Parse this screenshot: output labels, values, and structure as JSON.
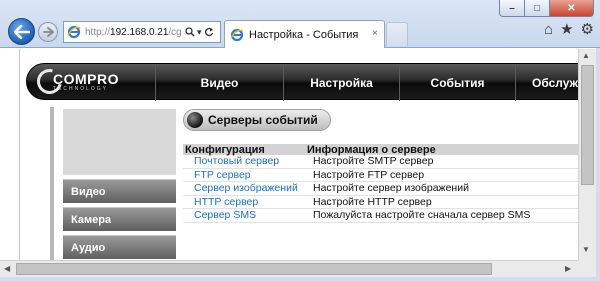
{
  "browser": {
    "address_url_prefix": "http://",
    "address_url_host": "192.168.0.21",
    "address_url_rest": "/cg",
    "tab_title": "Настройка - События",
    "tab_close": "×",
    "window_buttons": [
      "–",
      "□",
      "✕"
    ],
    "icons": [
      "back-arrow-icon",
      "forward-arrow-icon",
      "ie-logo-icon",
      "search-icon",
      "dropdown-icon",
      "refresh-icon",
      "home-icon",
      "favorites-star-icon",
      "gear-icon"
    ]
  },
  "site": {
    "logo_main": "COMPRO",
    "logo_sub": "TECHNOLOGY",
    "menu": [
      "Видео",
      "Настройка",
      "События",
      "Обслужи"
    ]
  },
  "sidebar": {
    "items": [
      "Видео",
      "Камера",
      "Аудио"
    ]
  },
  "section": {
    "title": "Серверы событий"
  },
  "table": {
    "headers": [
      "Конфигурация",
      "Информация о сервере"
    ],
    "rows": [
      {
        "name": "Почтовый сервер",
        "info": "Настройте SMTP сервер"
      },
      {
        "name": "FTP сервер",
        "info": "Настройте FTP сервер"
      },
      {
        "name": "Сервер изображений",
        "info": "Настройте сервер изображений"
      },
      {
        "name": "HTTP сервер",
        "info": "Настройте HTTP сервер"
      },
      {
        "name": "Сервер SMS",
        "info": "Пожалуйста настройте сначала сервер SMS"
      }
    ]
  },
  "colors": {
    "link": "#1e6fcf",
    "ie_accent": "#1b5fb6",
    "menu_bar": "#111111"
  }
}
